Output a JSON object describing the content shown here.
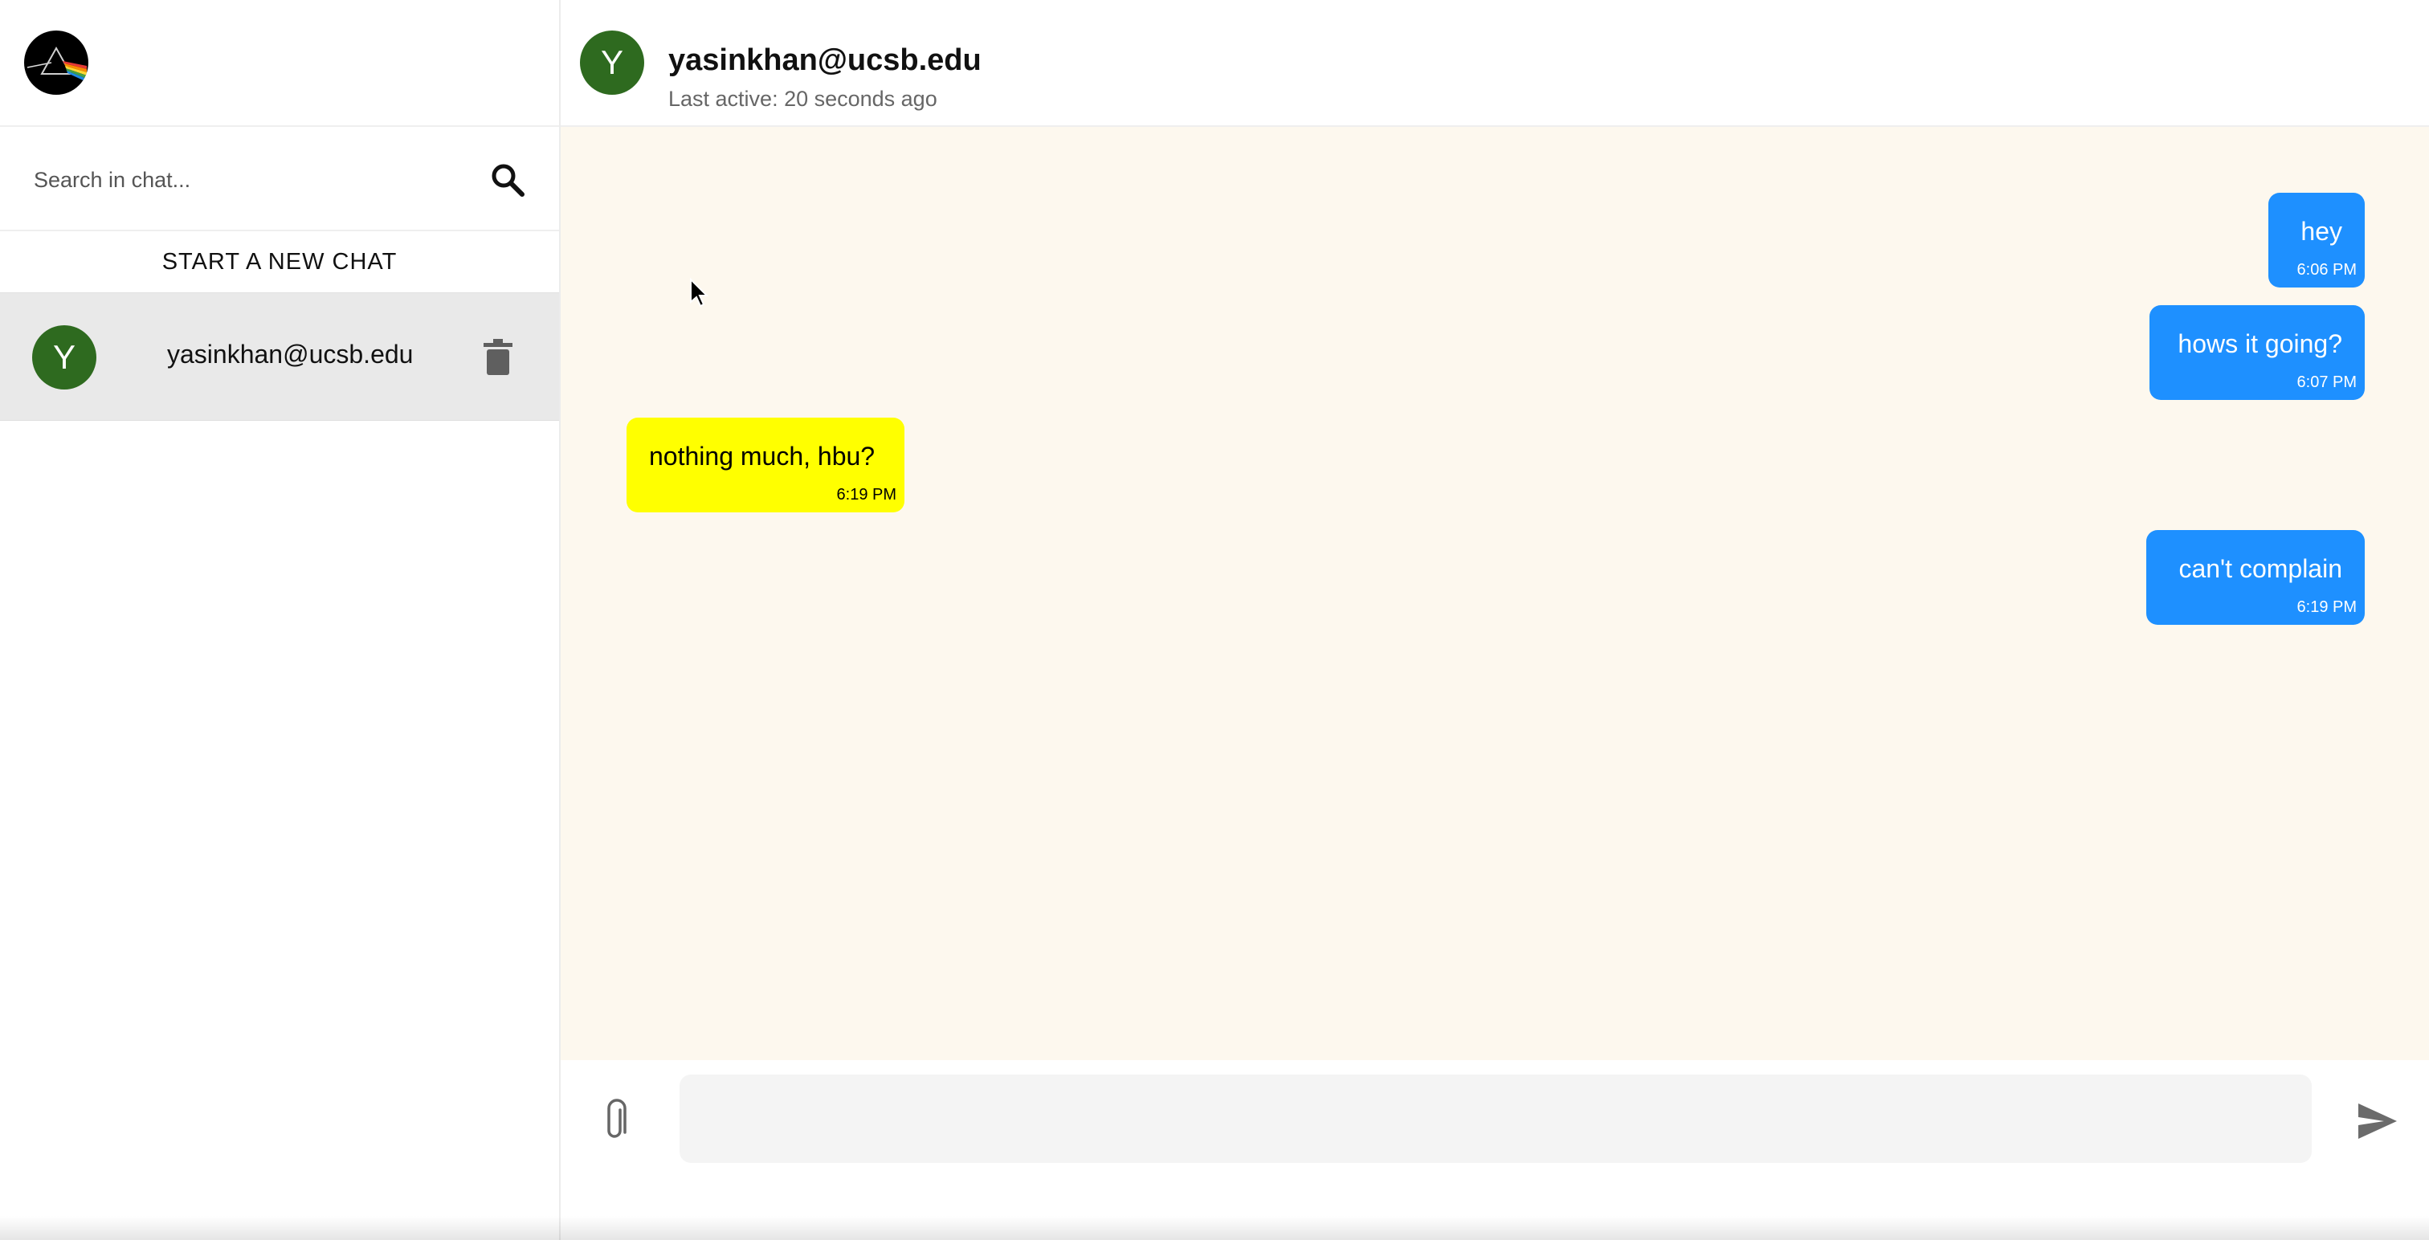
{
  "sidebar": {
    "search_placeholder": "Search in chat...",
    "new_chat_label": "START A NEW CHAT",
    "chats": [
      {
        "avatar_letter": "Y",
        "name": "yasinkhan@ucsb.edu"
      }
    ]
  },
  "header": {
    "avatar_letter": "Y",
    "name": "yasinkhan@ucsb.edu",
    "status": "Last active: 20 seconds ago"
  },
  "messages": [
    {
      "direction": "sent",
      "text": "hey",
      "time": "6:06 PM"
    },
    {
      "direction": "sent",
      "text": "hows it going?",
      "time": "6:07 PM"
    },
    {
      "direction": "received",
      "text": "nothing much, hbu?",
      "time": "6:19 PM"
    },
    {
      "direction": "sent",
      "text": "can't complain",
      "time": "6:19 PM"
    }
  ],
  "composer": {
    "value": ""
  },
  "colors": {
    "avatar": "#2e6a1f",
    "sent_bubble": "#1e90ff",
    "received_bubble": "#ffff00",
    "chat_background": "#fdf8ee"
  },
  "icons": {
    "logo": "prism-logo-icon",
    "search": "search-icon",
    "delete": "trash-icon",
    "attach": "paperclip-icon",
    "send": "send-icon"
  }
}
